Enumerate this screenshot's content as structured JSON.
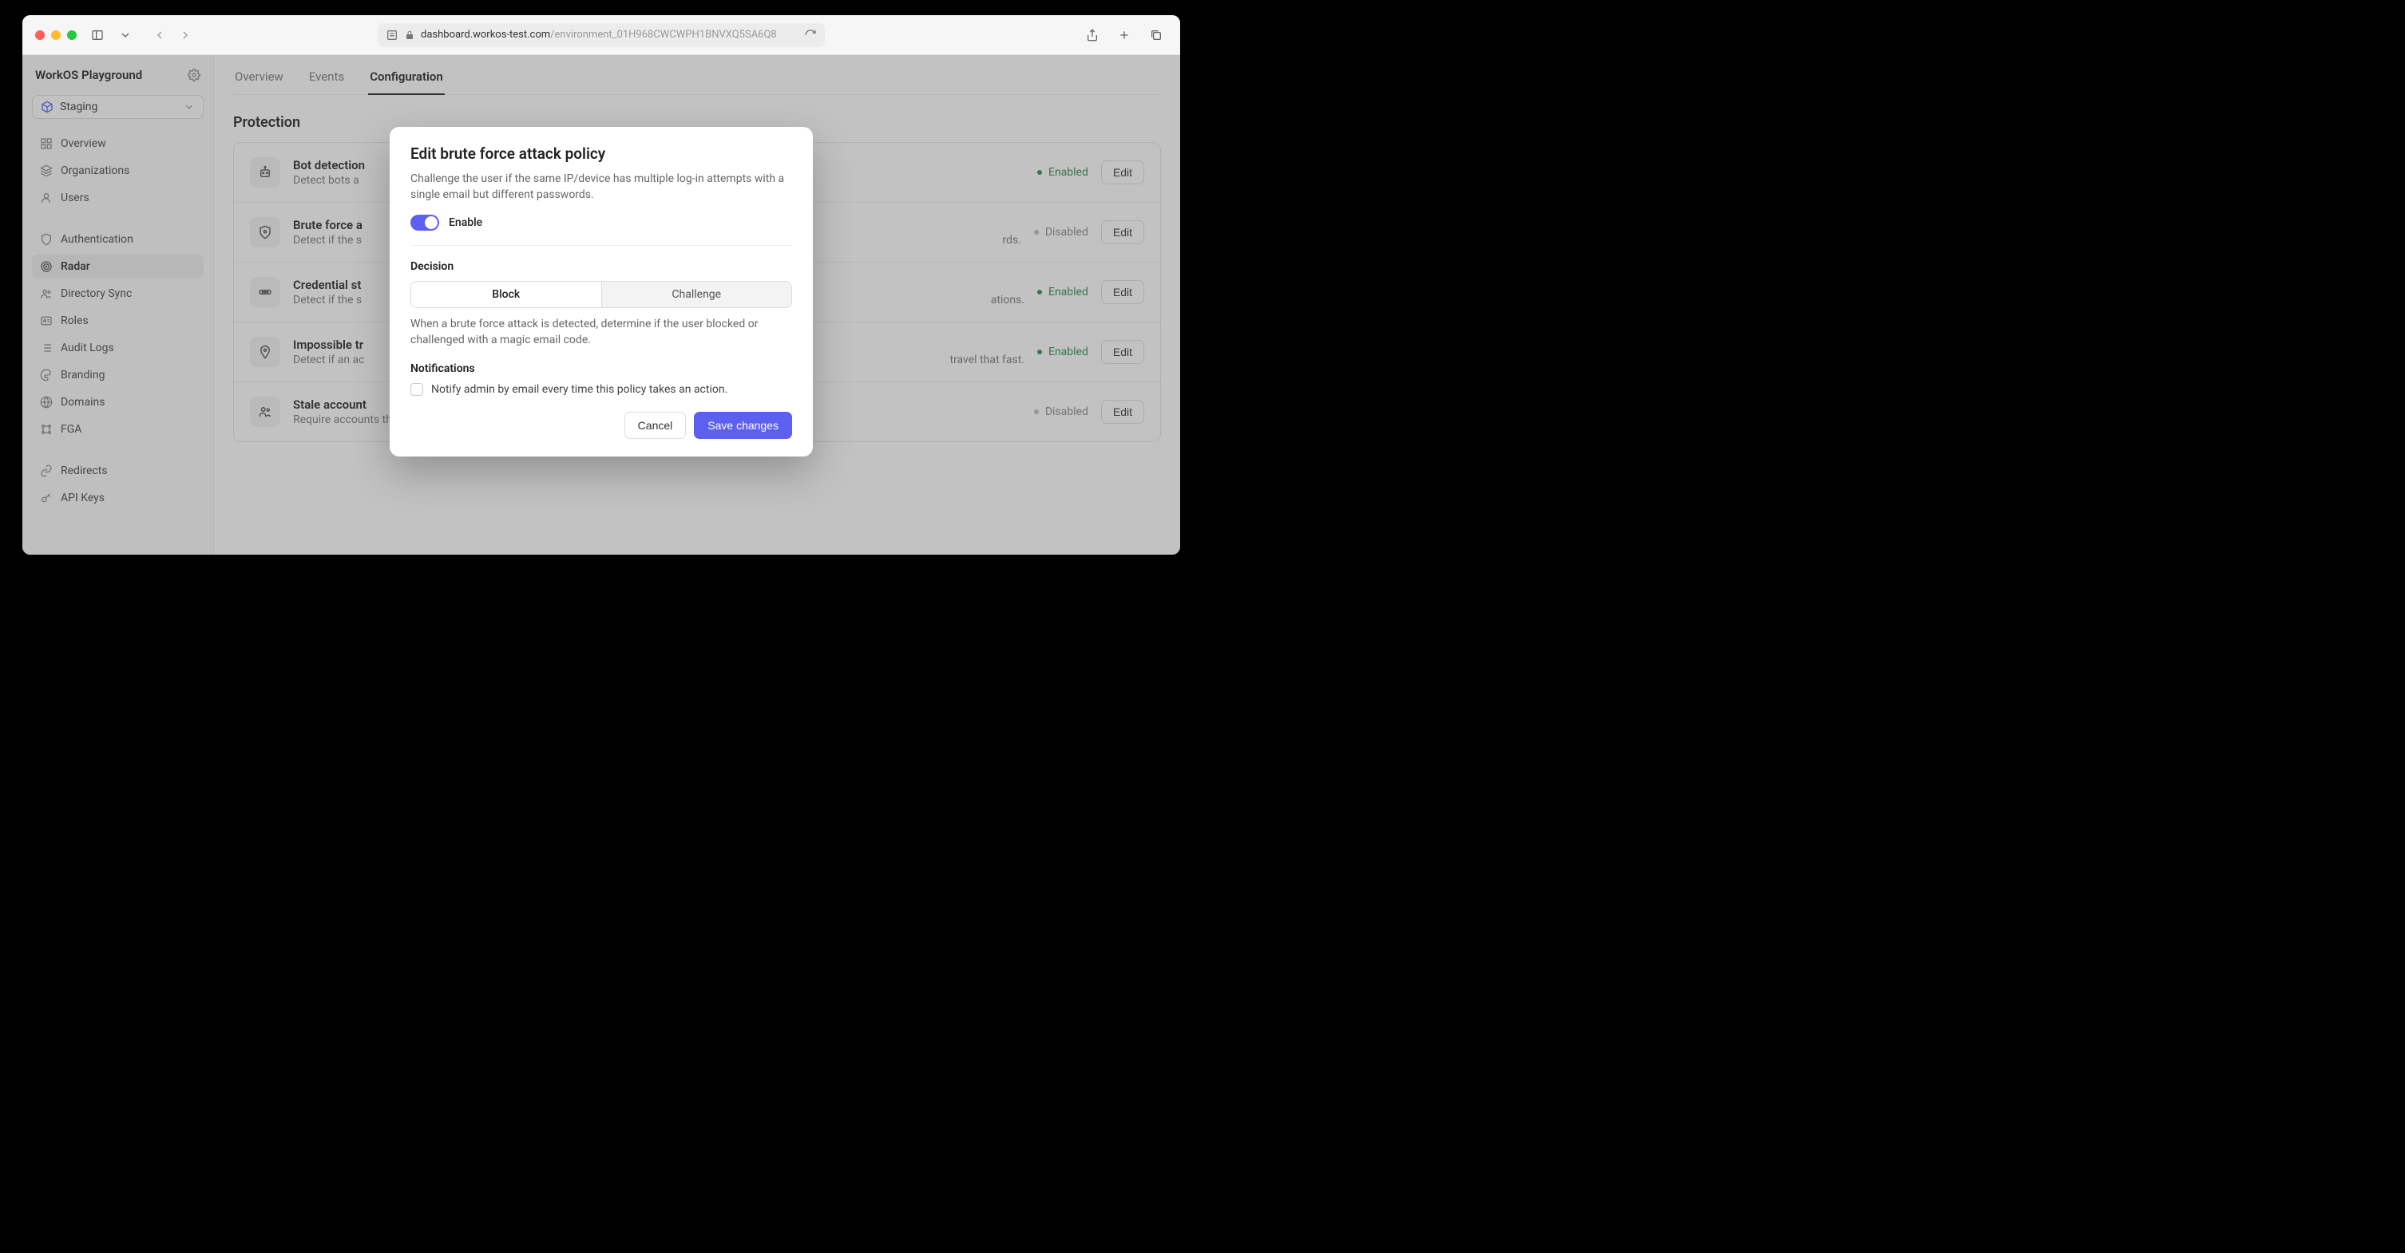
{
  "browser": {
    "url_host": "dashboard.workos-test.com",
    "url_path": "/environment_01H968CWCWPH1BNVXQ5SA6Q8"
  },
  "sidebar": {
    "title": "WorkOS Playground",
    "env": "Staging",
    "items": {
      "overview": "Overview",
      "organizations": "Organizations",
      "users": "Users",
      "authentication": "Authentication",
      "radar": "Radar",
      "directory_sync": "Directory Sync",
      "roles": "Roles",
      "audit_logs": "Audit Logs",
      "branding": "Branding",
      "domains": "Domains",
      "fga": "FGA",
      "redirects": "Redirects",
      "api_keys": "API Keys"
    }
  },
  "tabs": {
    "overview": "Overview",
    "events": "Events",
    "configuration": "Configuration"
  },
  "section": "Protection",
  "policies": [
    {
      "title": "Bot detection",
      "desc": "Detect bots a",
      "status": "Enabled",
      "edit": "Edit"
    },
    {
      "title": "Brute force a",
      "desc": "Detect if the s",
      "status": "Disabled",
      "edit": "Edit",
      "desc_tail": "rds."
    },
    {
      "title": "Credential st",
      "desc": "Detect if the s",
      "status": "Enabled",
      "edit": "Edit",
      "desc_tail": "ations."
    },
    {
      "title": "Impossible tr",
      "desc": "Detect if an ac",
      "status": "Enabled",
      "edit": "Edit",
      "desc_tail": " travel that fast."
    },
    {
      "title": "Stale account",
      "desc": "Require accounts that are dormant to authenticate again.",
      "status": "Disabled",
      "edit": "Edit"
    }
  ],
  "modal": {
    "title": "Edit brute force attack policy",
    "desc": "Challenge the user if the same IP/device has multiple log-in attempts with a single email but different passwords.",
    "enable": "Enable",
    "decision_h": "Decision",
    "block": "Block",
    "challenge": "Challenge",
    "decision_help": "When a brute force attack is detected, determine if the user blocked or challenged with a magic email code.",
    "notifications_h": "Notifications",
    "notify_label": "Notify admin by email every time this policy takes an action.",
    "cancel": "Cancel",
    "save": "Save changes"
  }
}
